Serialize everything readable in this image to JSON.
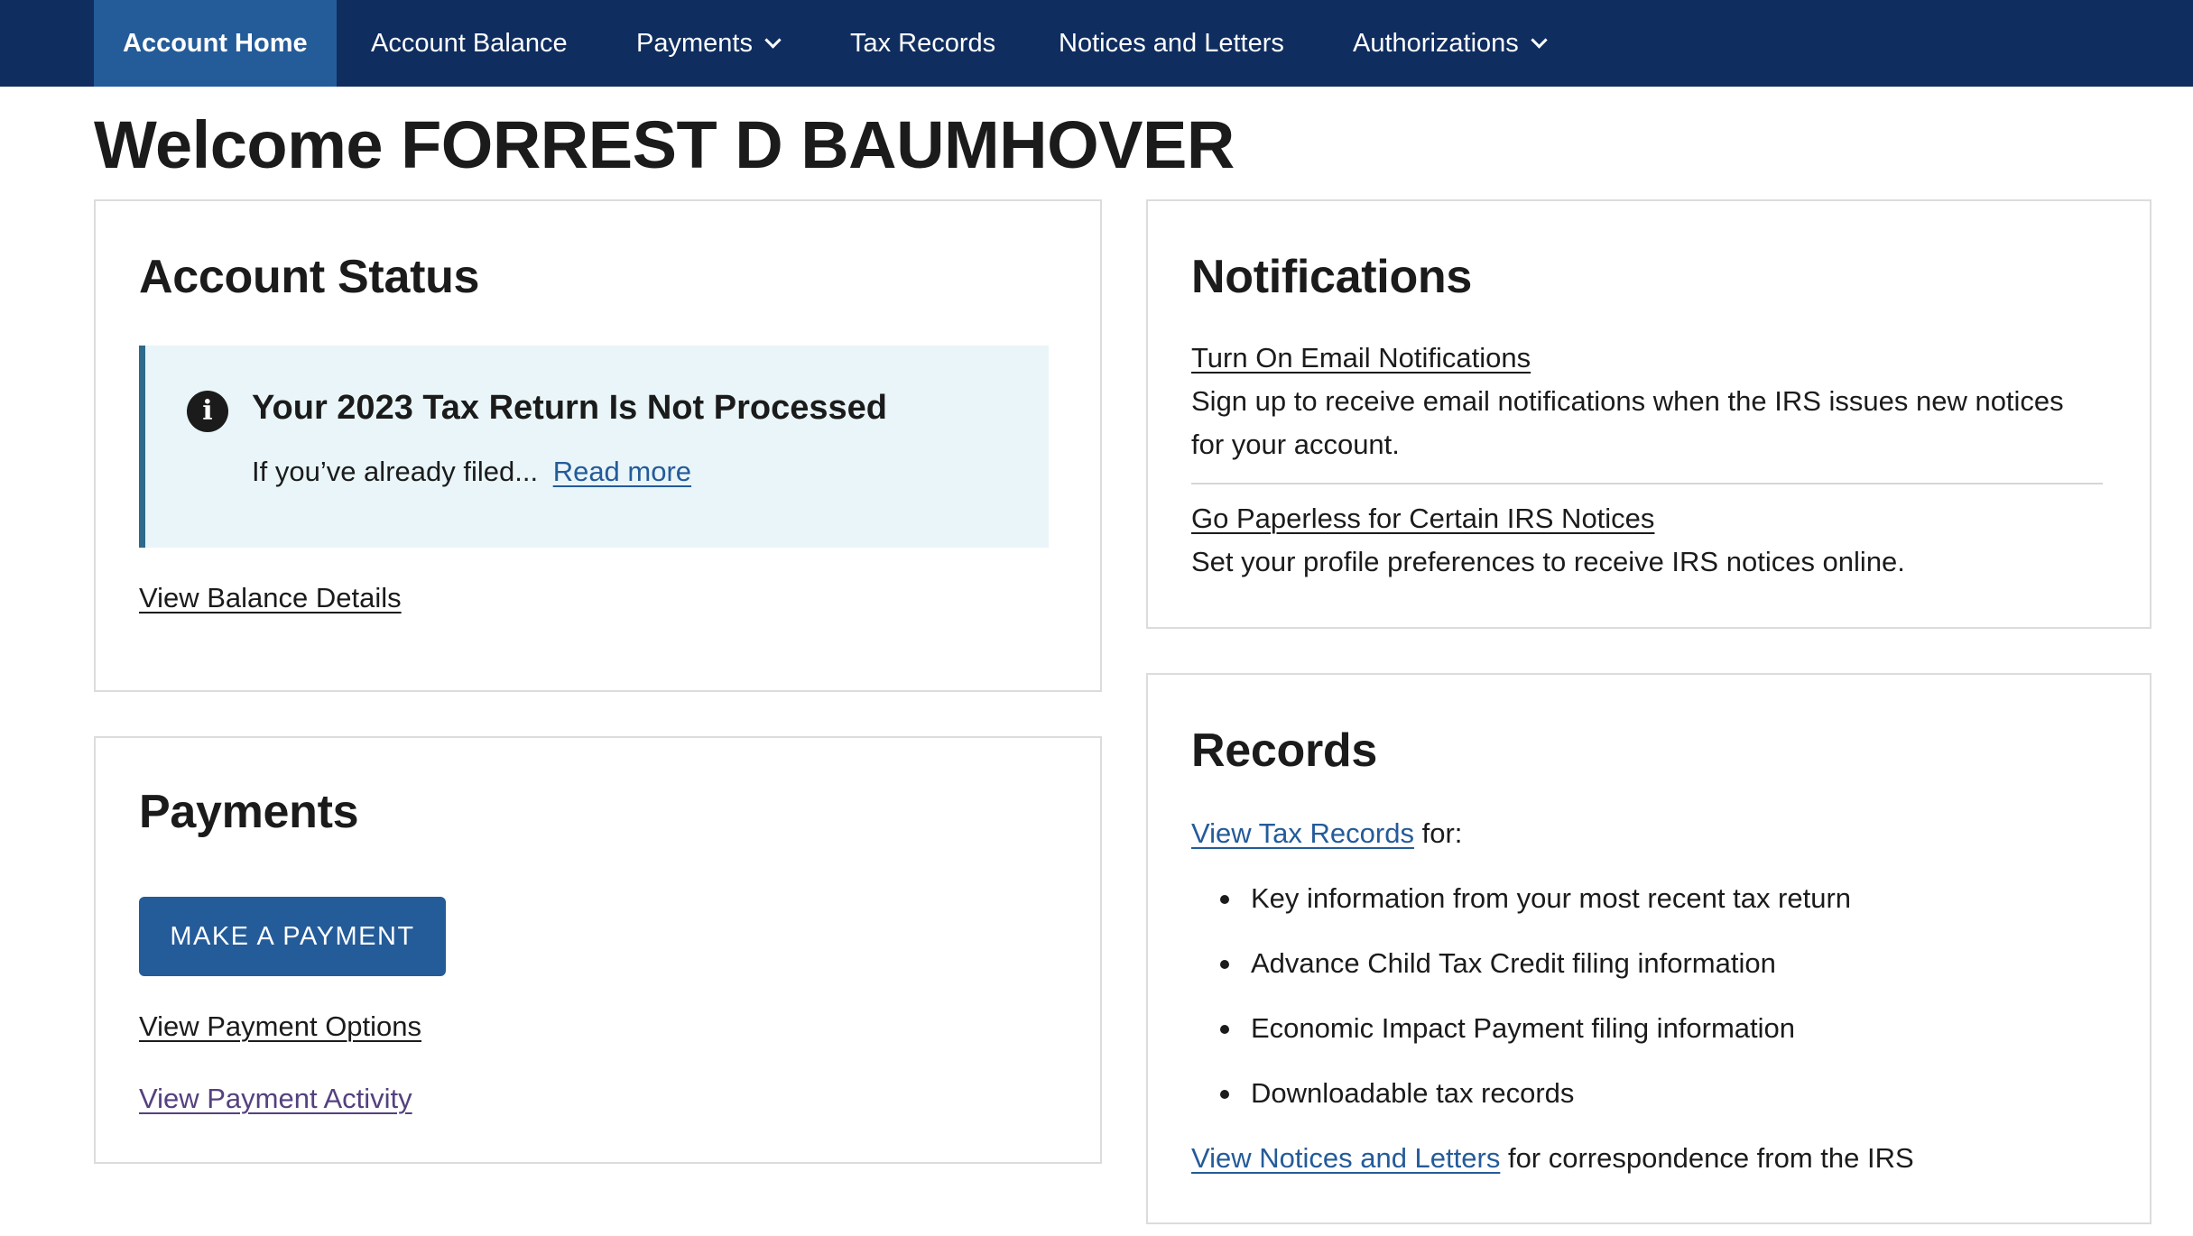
{
  "nav": {
    "items": [
      {
        "label": "Account Home",
        "active": true,
        "dropdown": false
      },
      {
        "label": "Account Balance",
        "active": false,
        "dropdown": false
      },
      {
        "label": "Payments",
        "active": false,
        "dropdown": true
      },
      {
        "label": "Tax Records",
        "active": false,
        "dropdown": false
      },
      {
        "label": "Notices and Letters",
        "active": false,
        "dropdown": false
      },
      {
        "label": "Authorizations",
        "active": false,
        "dropdown": true
      }
    ]
  },
  "page": {
    "title": "Welcome FORREST D BAUMHOVER"
  },
  "account_status": {
    "heading": "Account Status",
    "alert": {
      "icon": "info-icon",
      "title": "Your 2023 Tax Return Is Not Processed",
      "body": "If you’ve already filed...",
      "link": "Read more"
    },
    "link": "View Balance Details"
  },
  "payments": {
    "heading": "Payments",
    "button": "MAKE A PAYMENT",
    "links": [
      "View Payment Options",
      "View Payment Activity"
    ]
  },
  "notifications": {
    "heading": "Notifications",
    "items": [
      {
        "link": "Turn On Email Notifications",
        "description": "Sign up to receive email notifications when the IRS issues new notices for your account."
      },
      {
        "link": "Go Paperless for Certain IRS Notices",
        "description": "Set your profile preferences to receive IRS notices online."
      }
    ]
  },
  "records": {
    "heading": "Records",
    "intro_link": "View Tax Records",
    "intro_suffix": " for:",
    "bullets": [
      "Key information from your most recent tax return",
      "Advance Child Tax Credit filing information",
      "Economic Impact Payment filing information",
      "Downloadable tax records"
    ],
    "footer_link": "View Notices and Letters",
    "footer_suffix": " for correspondence from the IRS"
  },
  "colors": {
    "nav_bg": "#0f2d5f",
    "nav_active": "#245b99",
    "link": "#245b99",
    "visited_link": "#54417f",
    "alert_bg": "#e9f5f8",
    "alert_border": "#2e6a8c",
    "button": "#245b99"
  }
}
